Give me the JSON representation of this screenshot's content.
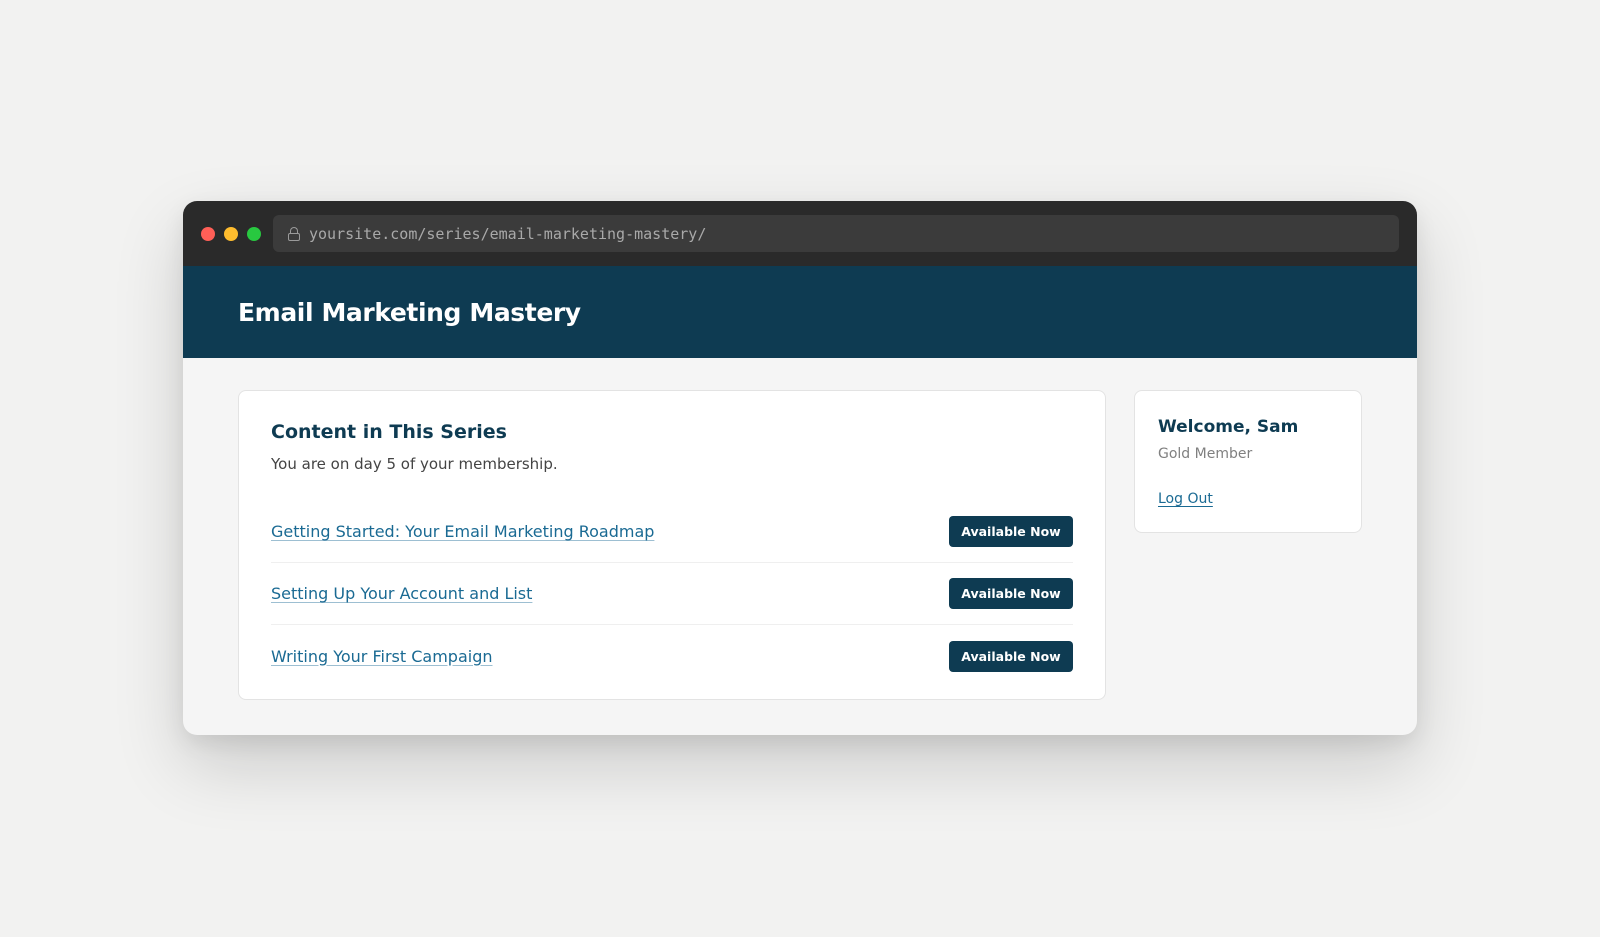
{
  "browser": {
    "url": "yoursite.com/series/email-marketing-mastery/"
  },
  "header": {
    "title": "Email Marketing Mastery"
  },
  "content": {
    "heading": "Content in This Series",
    "subtext": "You are on day 5 of your membership.",
    "items": [
      {
        "title": "Getting Started: Your Email Marketing Roadmap",
        "status": "Available Now"
      },
      {
        "title": "Setting Up Your Account and List",
        "status": "Available Now"
      },
      {
        "title": "Writing Your First Campaign",
        "status": "Available Now"
      }
    ]
  },
  "sidebar": {
    "welcome": "Welcome, Sam",
    "membership": "Gold Member",
    "logout_label": "Log Out"
  },
  "colors": {
    "brand": "#0e3b52",
    "link": "#1a6a93"
  }
}
